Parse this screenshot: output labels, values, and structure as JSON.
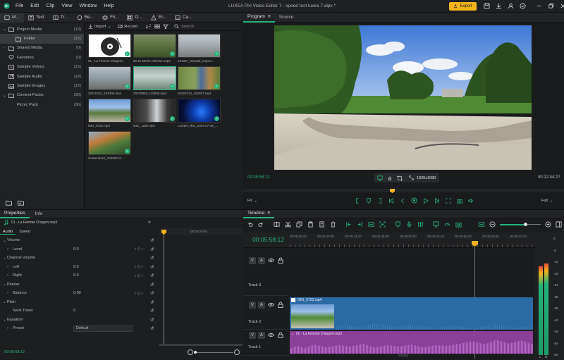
{
  "window": {
    "title": "LUXEA Pro Video Editor 7 - speed test luxea 7.alpx *"
  },
  "menu": [
    "File",
    "Edit",
    "Clip",
    "View",
    "Window",
    "Help"
  ],
  "export_label": "Export",
  "top_tabs": [
    {
      "label": "M...",
      "icon": "media-icon"
    },
    {
      "label": "Text",
      "icon": "text-icon"
    },
    {
      "label": "Tr...",
      "icon": "transition-icon"
    },
    {
      "label": "Be...",
      "icon": "behavior-icon"
    },
    {
      "label": "Fil...",
      "icon": "filter-icon"
    },
    {
      "label": "O...",
      "icon": "overlay-icon"
    },
    {
      "label": "El...",
      "icon": "element-icon"
    },
    {
      "label": "Ca...",
      "icon": "caption-icon"
    }
  ],
  "tree": [
    {
      "label": "Project Media",
      "count": "(10)",
      "icon": "folder-icon"
    },
    {
      "label": "Folder",
      "count": "(10)",
      "icon": "folder-icon"
    },
    {
      "label": "Shared Media",
      "count": "(0)",
      "icon": "folder-icon"
    },
    {
      "label": "Favorites",
      "count": "(0)",
      "icon": "heart-icon"
    },
    {
      "label": "Sample Videos",
      "count": "(15)",
      "icon": "video-icon"
    },
    {
      "label": "Sample Audio",
      "count": "(18)",
      "icon": "audio-icon"
    },
    {
      "label": "Sample Images",
      "count": "(12)",
      "icon": "image-icon"
    },
    {
      "label": "Content Packs",
      "count": "(36)",
      "icon": "folder-icon"
    },
    {
      "label": "Picnic Pack",
      "count": "(36)",
      "icon": ""
    }
  ],
  "media_toolbar": {
    "import": "Import",
    "record": "Record",
    "search_placeholder": "Search"
  },
  "media": [
    "01 - La Femme D'argent...",
    "09-11 Menlo Atherton.mp4",
    "101027_025128_Import...",
    "20211012_152305.mp4",
    "20220826_115006.mp4",
    "20221014_154027.mp4",
    "IMG_0722.mp4",
    "IMG_1250.mp4",
    "LUXEA_Rec_2024-07-16_...",
    "shutterstock_10200712..."
  ],
  "player": {
    "tabs": [
      "Program",
      "Source"
    ],
    "current_time": "00:05:58:12",
    "total_time": "00:12:44:27",
    "resolution": "1920x1080",
    "fit": "Fit",
    "quality": "Full"
  },
  "properties": {
    "tabs": [
      "Properties",
      "Info"
    ],
    "clip_name": "01 - La Femme D'argent.mp3",
    "subtabs": [
      "Audio",
      "Speed"
    ],
    "rows": [
      {
        "label": "Volume",
        "value": "",
        "indent": 0
      },
      {
        "label": "Level",
        "value": "0.0",
        "indent": 1
      },
      {
        "label": "Channel Volume",
        "value": "",
        "indent": 0
      },
      {
        "label": "Left",
        "value": "0.0",
        "indent": 1
      },
      {
        "label": "Right",
        "value": "0.0",
        "indent": 1
      },
      {
        "label": "Panner",
        "value": "",
        "indent": 0
      },
      {
        "label": "Balance",
        "value": "0.00",
        "indent": 1
      },
      {
        "label": "Pitch",
        "value": "",
        "indent": 0
      },
      {
        "label": "Semi Tones",
        "value": "0",
        "indent": 1
      },
      {
        "label": "Equalizer",
        "value": "",
        "indent": 0
      },
      {
        "label": "Preset",
        "value": "Default",
        "indent": 1
      }
    ],
    "ruler_time": "00:00:20:00",
    "bottom_time": "00:05:58:12"
  },
  "timeline": {
    "title": "Timeline",
    "current_time": "00:05:58:12",
    "ruler": [
      "00:05:26:20",
      "00:05:40:00",
      "00:05:43:10",
      "00:05:46:20",
      "00:05:50:00",
      "00:05:53:10",
      "00:05:56:20",
      "00:06:00:00",
      "00:06:03:10"
    ],
    "tracks": [
      "Track 3",
      "Track 2",
      "Track 1"
    ],
    "clips": {
      "video": "IMG_0722.mp4",
      "audio": "01 - La Femme D'argent.mp3"
    },
    "meter_scale": [
      "0",
      "-6",
      "-12",
      "-18",
      "-24",
      "-30",
      "-36",
      "-42",
      "-48",
      "-54",
      "-60"
    ],
    "meter_lr": [
      "L",
      "R"
    ]
  },
  "colors": {
    "accent": "#24b37a",
    "export": "#f2b41a",
    "video_clip": "#2b6aa3",
    "audio_clip": "#8a3f98"
  }
}
